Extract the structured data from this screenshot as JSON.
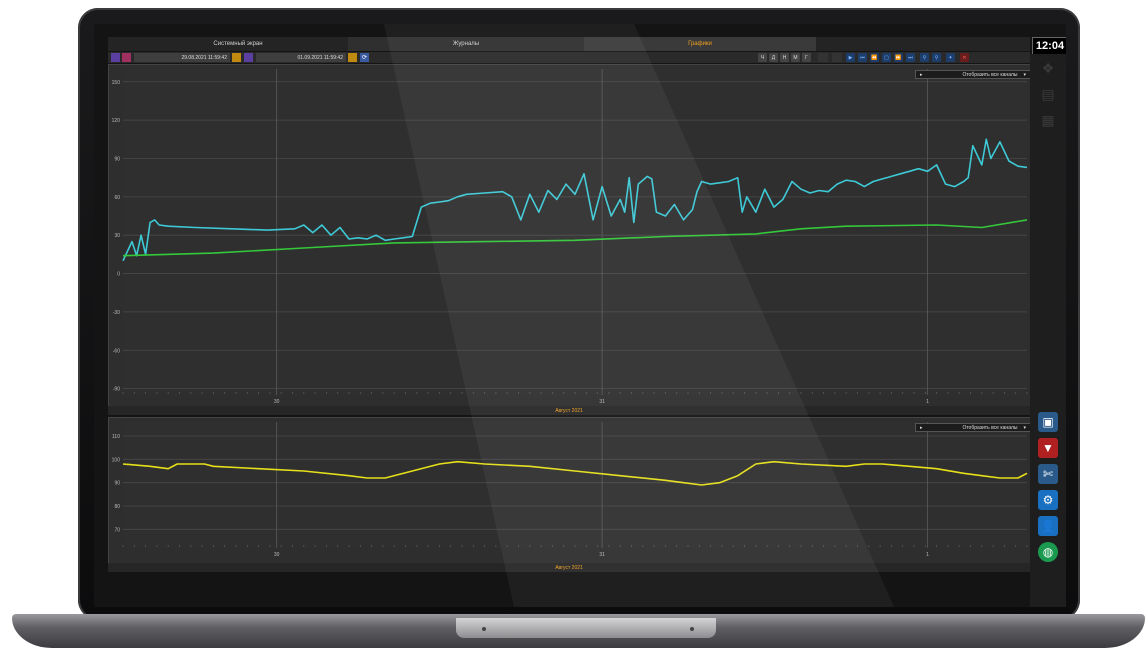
{
  "tabs": [
    {
      "label": "Системный экран",
      "active": false
    },
    {
      "label": "Журналы",
      "active": false
    },
    {
      "label": "Графики",
      "active": true
    }
  ],
  "clock": "12:04",
  "toolbar": {
    "date_from": "29.08.2021 11:59:42",
    "date_to": "01.09.2021 11:59:42",
    "period_buttons": [
      "Ч",
      "Д",
      "Н",
      "М",
      "Г"
    ],
    "nav_icons": [
      "play-icon",
      "skip-start-icon",
      "rewind-icon",
      "frame-icon",
      "fast-forward-icon",
      "skip-end-icon",
      "zoom-in-icon",
      "zoom-out-icon",
      "pin-icon",
      "close-icon"
    ]
  },
  "colors": {
    "accent": "#f0a020",
    "cyan_series": "#3ec9d6",
    "green_series": "#34c83a",
    "yellow_series": "#e6e01a"
  },
  "side_icons": [
    "layers-icon",
    "document-icon",
    "chart-icon",
    "monitor-icon",
    "antenna-icon",
    "settings-icon",
    "user-icon",
    "globe-icon"
  ],
  "chart_data": [
    {
      "type": "line",
      "dropdown": "Отобразить все каналы",
      "month_label": "Август 2021",
      "y_ticks": [
        150,
        120,
        90,
        60,
        30,
        0,
        -30,
        -60,
        -90
      ],
      "ylim": [
        -95,
        160
      ],
      "x_ticks": [
        "30",
        "31",
        "1"
      ],
      "xlim": [
        0,
        100
      ],
      "series": [
        {
          "color": "#3ec9d6",
          "x": [
            0,
            1,
            1.5,
            2,
            2.5,
            3,
            3.5,
            4,
            5,
            8,
            12,
            16,
            19,
            20,
            21,
            22,
            23,
            24,
            25,
            26,
            27,
            28,
            29,
            30,
            31,
            32,
            33,
            34,
            35,
            36,
            37,
            38,
            40,
            42,
            43,
            44,
            45,
            46,
            47,
            48,
            49,
            50,
            51,
            52,
            53,
            54,
            55,
            55.5,
            56,
            56.5,
            57,
            58,
            58.5,
            59,
            60,
            61,
            62,
            63,
            63.5,
            64,
            65,
            66,
            67,
            68,
            68.5,
            69,
            70,
            71,
            72,
            73,
            74,
            75,
            76,
            77,
            78,
            79,
            80,
            81,
            82,
            83,
            84,
            85,
            86,
            87,
            88,
            89,
            90,
            91,
            92,
            93,
            93.5,
            94,
            95,
            95.5,
            96,
            97,
            98,
            99,
            100
          ],
          "y": [
            10,
            25,
            14,
            30,
            15,
            40,
            42,
            38,
            37,
            36,
            35,
            34,
            35,
            38,
            32,
            38,
            30,
            36,
            27,
            28,
            27,
            30,
            26,
            27,
            28,
            29,
            52,
            55,
            56,
            57,
            60,
            62,
            63,
            64,
            60,
            42,
            62,
            48,
            65,
            58,
            70,
            62,
            78,
            42,
            68,
            45,
            58,
            48,
            75,
            40,
            70,
            76,
            74,
            48,
            45,
            54,
            42,
            50,
            64,
            72,
            70,
            71,
            72,
            75,
            48,
            60,
            48,
            66,
            52,
            58,
            72,
            66,
            63,
            65,
            64,
            70,
            73,
            72,
            68,
            72,
            74,
            76,
            78,
            80,
            82,
            80,
            85,
            70,
            68,
            72,
            75,
            100,
            85,
            105,
            90,
            103,
            88,
            84,
            83
          ]
        },
        {
          "color": "#34c83a",
          "x": [
            0,
            10,
            20,
            30,
            40,
            50,
            60,
            70,
            75,
            80,
            90,
            95,
            100
          ],
          "y": [
            14,
            16,
            20,
            24,
            25,
            26,
            29,
            31,
            35,
            37,
            38,
            36,
            42
          ]
        }
      ]
    },
    {
      "type": "line",
      "dropdown": "Отобразить все каналы",
      "month_label": "Август 2021",
      "y_ticks": [
        110,
        100,
        90,
        80,
        70
      ],
      "ylim": [
        62,
        116
      ],
      "x_ticks": [
        "30",
        "31",
        "1"
      ],
      "xlim": [
        0,
        100
      ],
      "series": [
        {
          "color": "#e6e01a",
          "x": [
            0,
            3,
            5,
            6,
            9,
            10,
            15,
            20,
            25,
            27,
            29,
            32,
            35,
            37,
            40,
            45,
            50,
            55,
            60,
            62,
            64,
            66,
            68,
            70,
            72,
            75,
            80,
            82,
            84,
            87,
            90,
            93,
            95,
            97,
            99,
            100
          ],
          "y": [
            98,
            97,
            96,
            98,
            98,
            97,
            96,
            95,
            93,
            92,
            92,
            95,
            98,
            99,
            98,
            97,
            95,
            93,
            91,
            90,
            89,
            90,
            93,
            98,
            99,
            98,
            97,
            98,
            98,
            97,
            96,
            94,
            93,
            92,
            92,
            94
          ]
        }
      ]
    }
  ]
}
